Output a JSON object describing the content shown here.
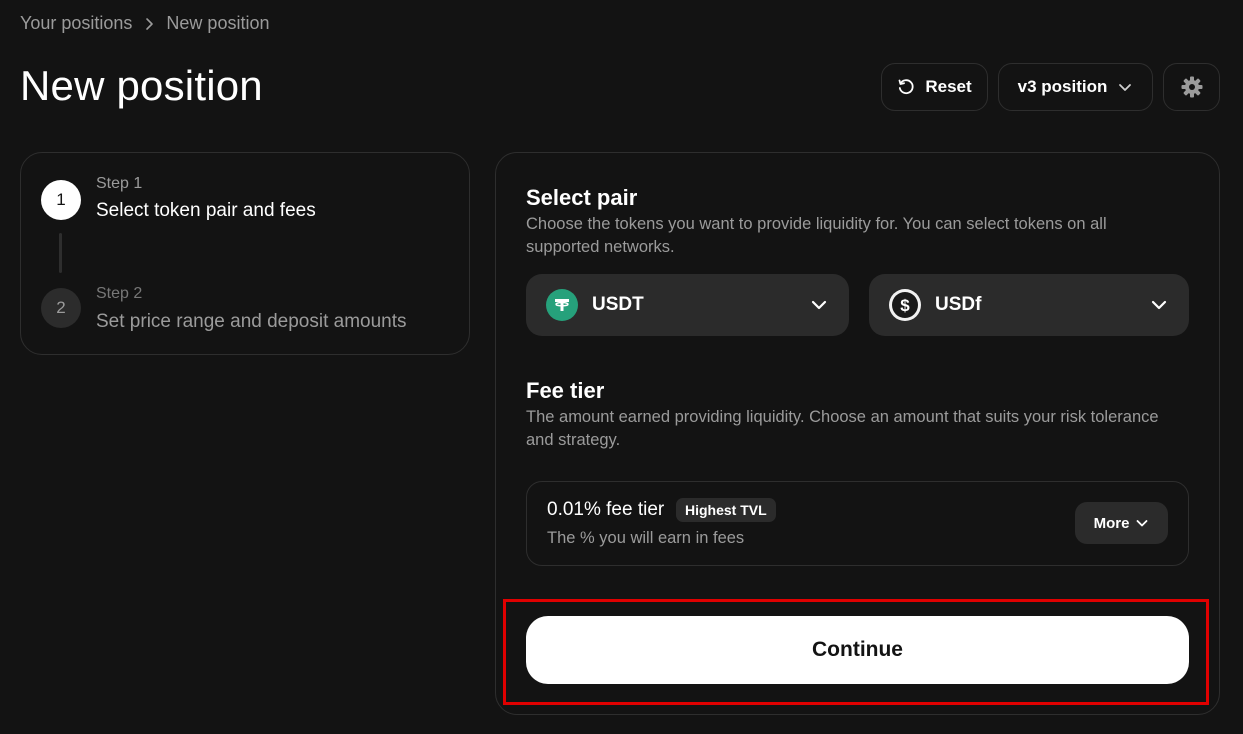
{
  "breadcrumb": {
    "parent": "Your positions",
    "current": "New position"
  },
  "page": {
    "title": "New position"
  },
  "toolbar": {
    "reset_label": "Reset",
    "version_label": "v3 position",
    "settings_icon": "gear-icon"
  },
  "steps": [
    {
      "number": "1",
      "kicker": "Step 1",
      "title": "Select token pair and fees",
      "active": true
    },
    {
      "number": "2",
      "kicker": "Step 2",
      "title": "Set price range and deposit amounts",
      "active": false
    }
  ],
  "select_pair": {
    "title": "Select pair",
    "description": "Choose the tokens you want to provide liquidity for. You can select tokens on all supported networks.",
    "token_a": {
      "symbol": "USDT",
      "icon": "tether-icon",
      "color": "#26a17b"
    },
    "token_b": {
      "symbol": "USDf",
      "icon": "dollar-coin-icon",
      "color": "#f2f2f2"
    }
  },
  "fee_tier": {
    "title": "Fee tier",
    "description": "The amount earned providing liquidity. Choose an amount that suits your risk tolerance and strategy.",
    "selected_label": "0.01% fee tier",
    "badge": "Highest TVL",
    "sub_label": "The % you will earn in fees",
    "more_label": "More"
  },
  "continue_label": "Continue",
  "colors": {
    "background": "#131313",
    "card_border": "#2e2e2e",
    "surface": "#2b2b2b",
    "muted_text": "#9b9b9b",
    "highlight": "#e00000"
  }
}
